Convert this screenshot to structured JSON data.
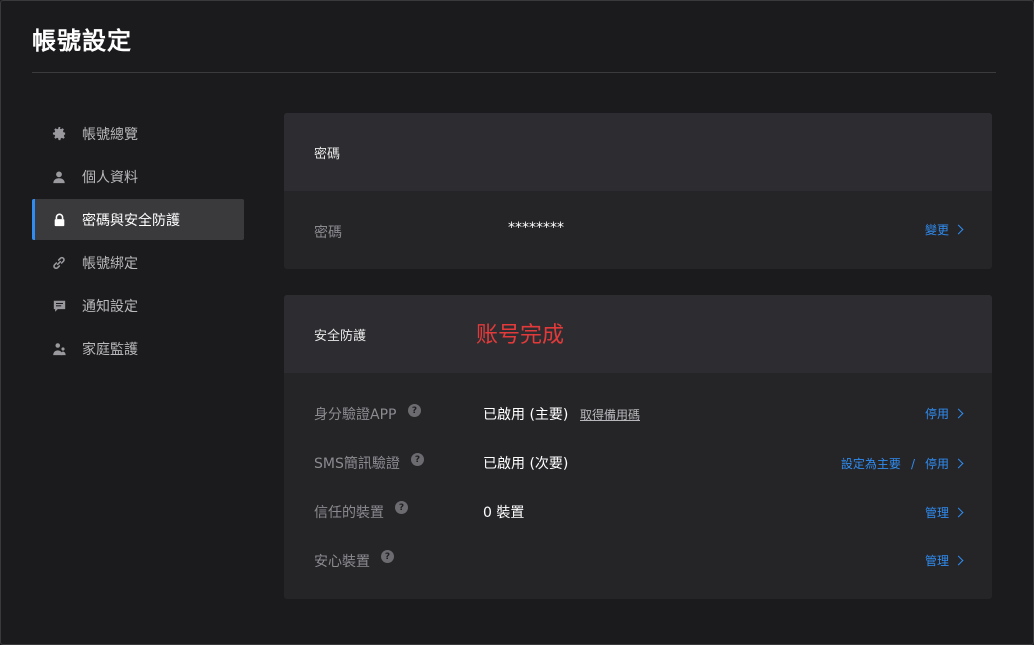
{
  "page": {
    "title": "帳號設定"
  },
  "sidebar": {
    "items": [
      {
        "label": "帳號總覽",
        "icon": "gear-icon"
      },
      {
        "label": "個人資料",
        "icon": "user-icon"
      },
      {
        "label": "密碼與安全防護",
        "icon": "lock-icon",
        "active": true
      },
      {
        "label": "帳號綁定",
        "icon": "link-icon"
      },
      {
        "label": "通知設定",
        "icon": "message-icon"
      },
      {
        "label": "家庭監護",
        "icon": "family-icon"
      }
    ]
  },
  "password_card": {
    "title": "密碼",
    "row": {
      "label": "密碼",
      "value": "********",
      "action": "變更"
    }
  },
  "security_card": {
    "title": "安全防護",
    "overlay_text": "账号完成",
    "rows": [
      {
        "label": "身分驗證APP",
        "value": "已啟用 (主要)",
        "extra_link": "取得備用碼",
        "action": "停用"
      },
      {
        "label": "SMS簡訊驗證",
        "value": "已啟用 (次要)",
        "secondary_action": "設定為主要",
        "separator": "/",
        "action": "停用"
      },
      {
        "label": "信任的裝置",
        "value": "0 裝置",
        "action": "管理"
      },
      {
        "label": "安心裝置",
        "value": "",
        "action": "管理"
      }
    ],
    "help_symbol": "?"
  },
  "colors": {
    "accent": "#2f8cf0",
    "background": "#1b1b1d",
    "card": "#252528",
    "card_header": "#2d2d31",
    "warning_text": "#e23a3a"
  }
}
